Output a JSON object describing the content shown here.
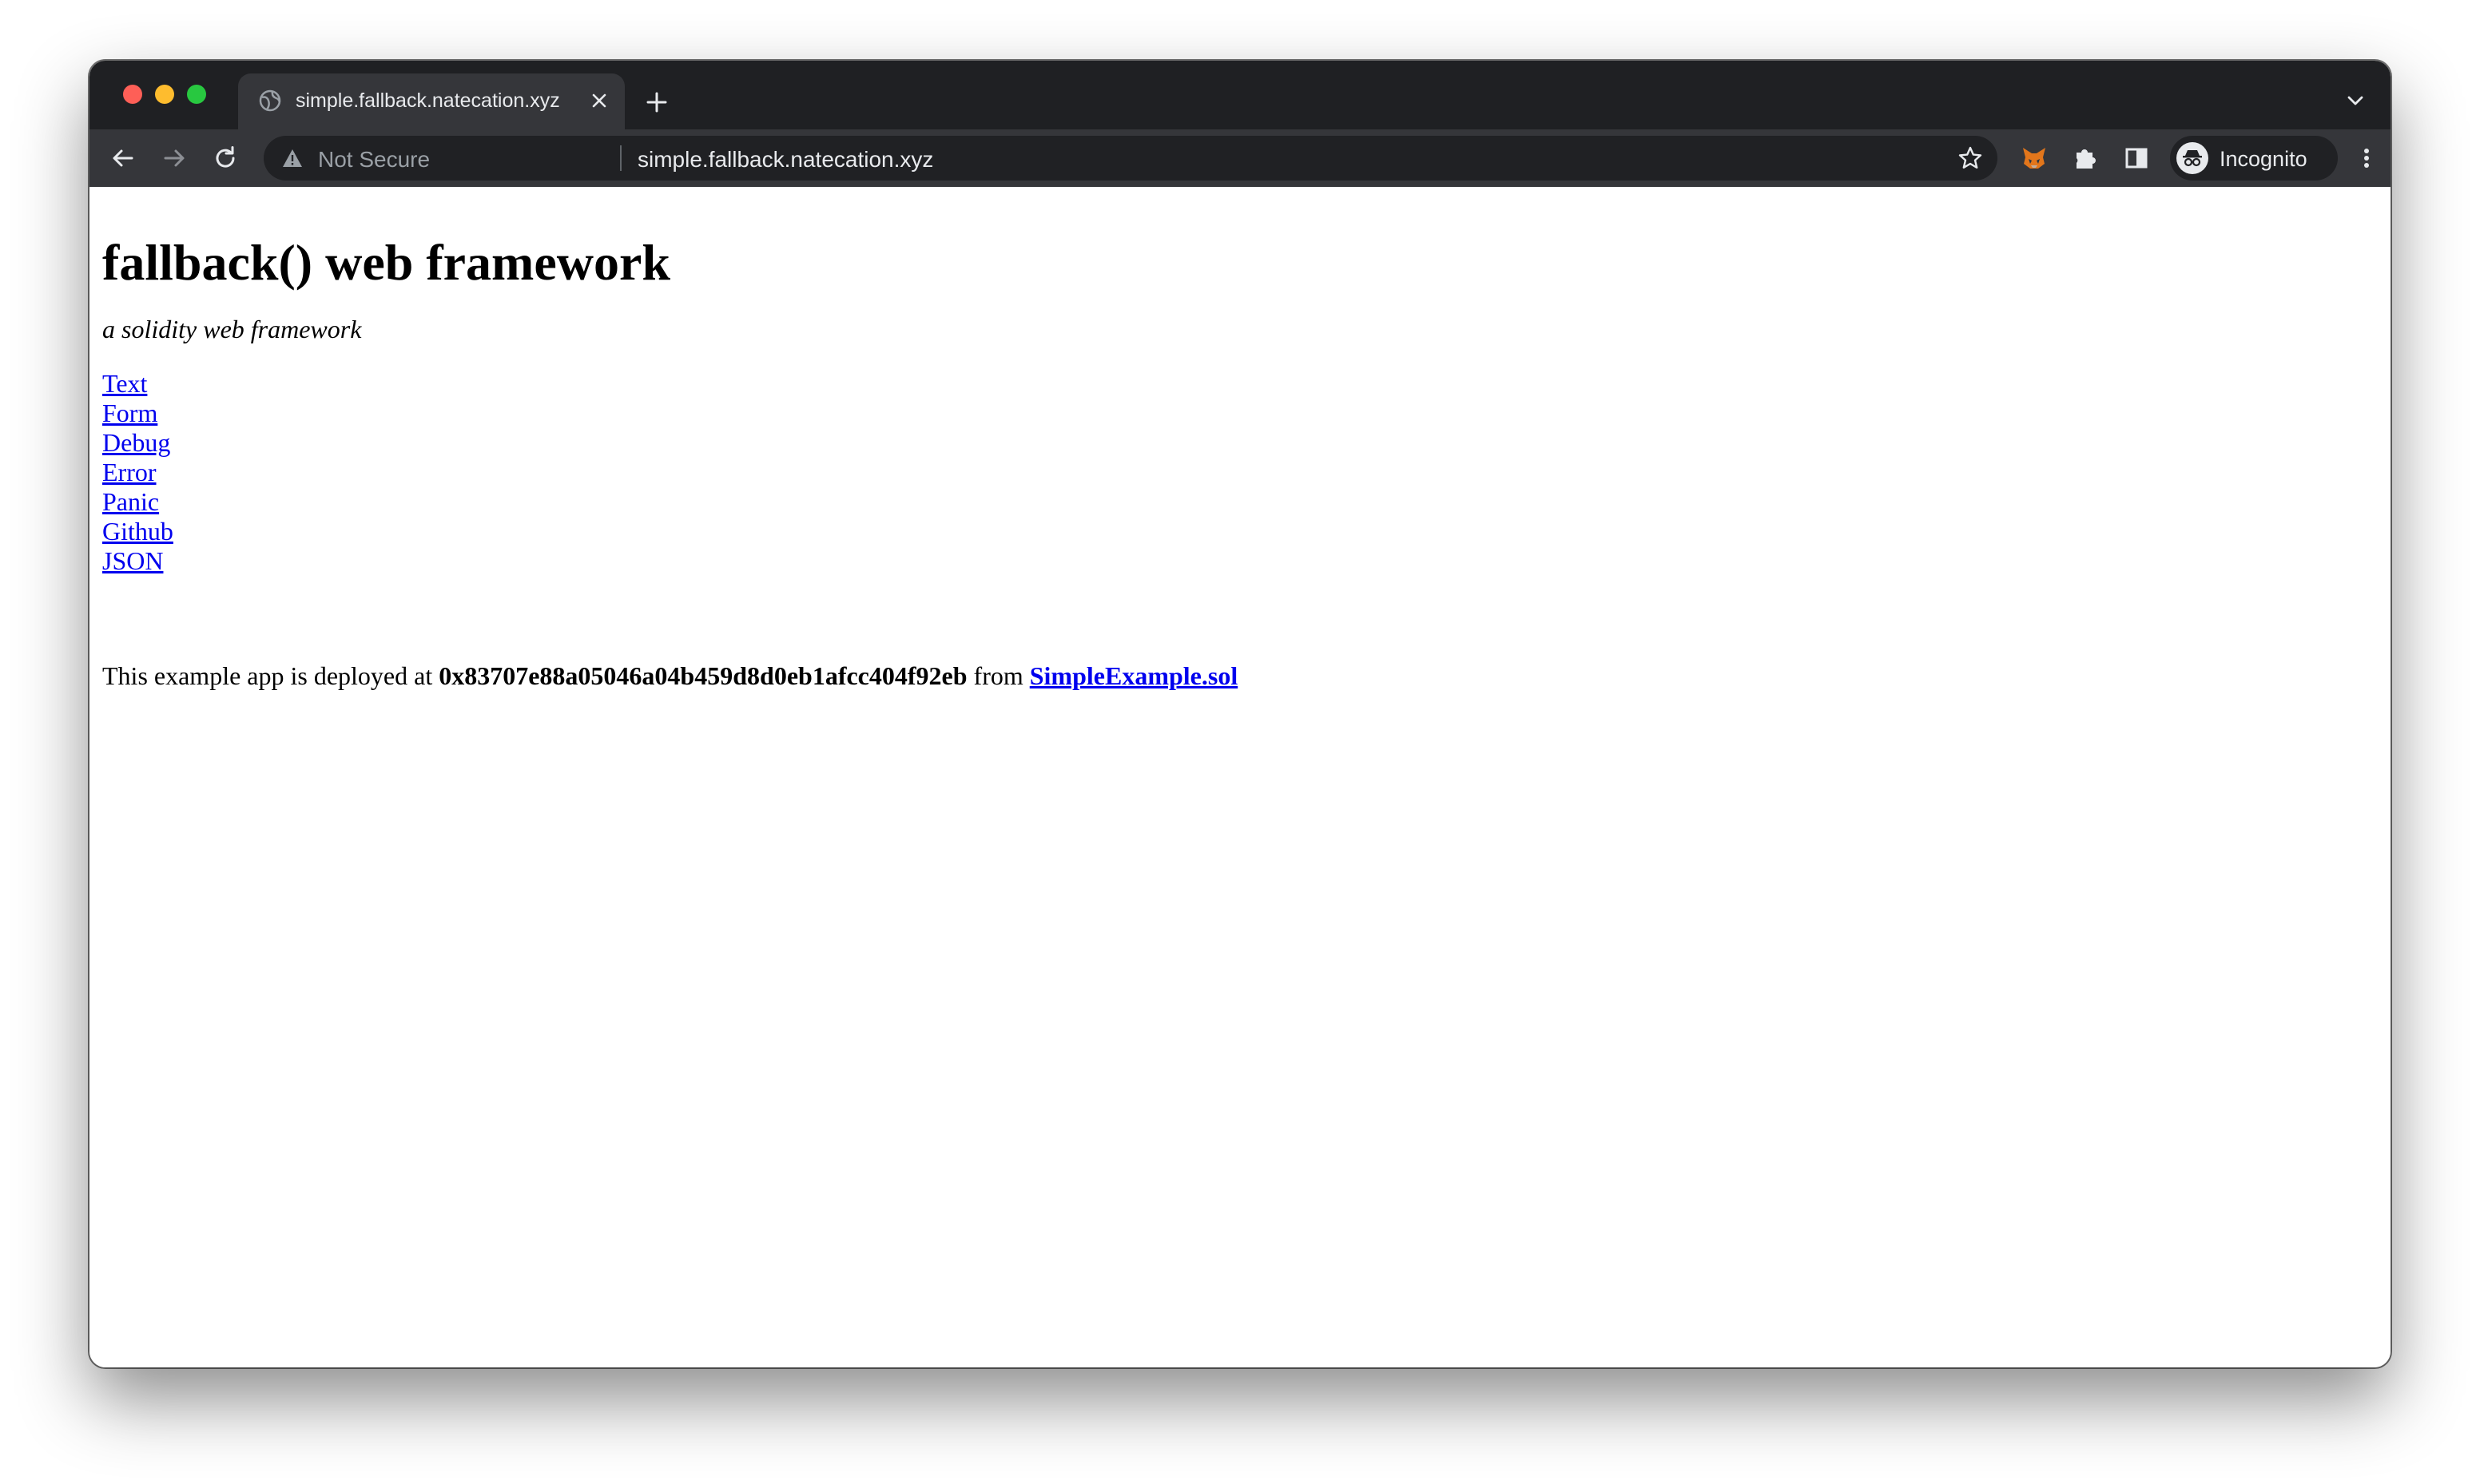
{
  "browser": {
    "tab": {
      "title": "simple.fallback.natecation.xyz"
    },
    "omnibox": {
      "security_label": "Not Secure",
      "url": "simple.fallback.natecation.xyz"
    },
    "profile": {
      "label": "Incognito"
    },
    "icons": {
      "favicon": "globe-icon",
      "close": "close-icon",
      "new_tab": "plus-icon",
      "back": "back-arrow-icon",
      "forward": "forward-arrow-icon",
      "reload": "reload-icon",
      "warning": "warning-icon",
      "bookmark": "star-icon",
      "metamask": "fox-icon",
      "extensions": "puzzle-icon",
      "side_panel": "side-panel-icon",
      "menu": "kebab-menu-icon"
    },
    "colors": {
      "tab_strip": "#1f2023",
      "toolbar": "#35363a",
      "omnibox": "#202124",
      "link": "#0000ee"
    }
  },
  "page": {
    "title": "fallback() web framework",
    "tagline": "a solidity web framework",
    "links": [
      {
        "label": "Text"
      },
      {
        "label": "Form"
      },
      {
        "label": "Debug"
      },
      {
        "label": "Error"
      },
      {
        "label": "Panic"
      },
      {
        "label": "Github"
      },
      {
        "label": "JSON"
      }
    ],
    "deploy": {
      "prefix": "This example app is deployed at",
      "address": "0x83707e88a05046a04b459d8d0eb1afcc404f92eb",
      "middle": "from",
      "source_link": "SimpleExample.sol"
    }
  }
}
